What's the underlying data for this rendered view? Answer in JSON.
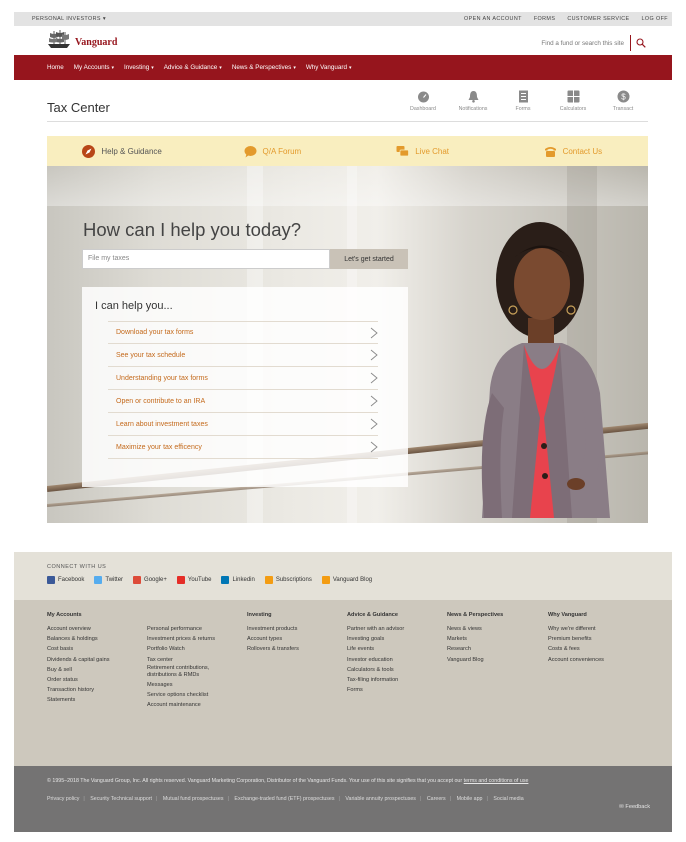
{
  "topbar": {
    "left": "PERSONAL INVESTORS",
    "left_caret": "▾",
    "links": [
      "OPEN AN ACCOUNT",
      "FORMS",
      "CUSTOMER SERVICE",
      "LOG OFF"
    ]
  },
  "brand": {
    "name": "Vanguard",
    "color": "#96151d"
  },
  "search": {
    "placeholder": "Find a fund or search this site"
  },
  "nav": [
    {
      "label": "Home",
      "caret": ""
    },
    {
      "label": "My Accounts",
      "caret": "▾"
    },
    {
      "label": "Investing",
      "caret": "▾"
    },
    {
      "label": "Advice & Guidance",
      "caret": "▾"
    },
    {
      "label": "News & Perspectives",
      "caret": "▾"
    },
    {
      "label": "Why Vanguard",
      "caret": "▾"
    }
  ],
  "page": {
    "title": "Tax Center"
  },
  "quick_tools": [
    {
      "label": "Dashboard",
      "icon": "dashboard-icon"
    },
    {
      "label": "Notifications",
      "icon": "bell-icon"
    },
    {
      "label": "Forms",
      "icon": "forms-icon"
    },
    {
      "label": "Calculators",
      "icon": "calculator-icon"
    },
    {
      "label": "Transact",
      "icon": "dollar-icon"
    }
  ],
  "tabs": [
    {
      "label": "Help & Guidance",
      "icon": "compass-icon",
      "active": true
    },
    {
      "label": "Q/A Forum",
      "icon": "chat-bubble-icon",
      "active": false
    },
    {
      "label": "Live Chat",
      "icon": "live-chat-icon",
      "active": false
    },
    {
      "label": "Contact Us",
      "icon": "phone-icon",
      "active": false
    }
  ],
  "hero": {
    "heading": "How can I help you today?",
    "input_placeholder": "File my taxes",
    "button": "Let's get started",
    "help_title": "I can help you...",
    "help_items": [
      "Download your tax forms",
      "See your tax schedule",
      "Understanding your tax forms",
      "Open or contribute to an IRA",
      "Learn about investment taxes",
      "Maximize your tax efficency"
    ]
  },
  "connect": {
    "label": "CONNECT WITH US",
    "socials": [
      {
        "label": "Facebook",
        "color": "#3b5998"
      },
      {
        "label": "Twitter",
        "color": "#55acee"
      },
      {
        "label": "Google+",
        "color": "#dd4b39"
      },
      {
        "label": "YouTube",
        "color": "#e52d27"
      },
      {
        "label": "Linkedin",
        "color": "#0077b5"
      },
      {
        "label": "Subscriptions",
        "color": "#f39c12"
      },
      {
        "label": "Vanguard Blog",
        "color": "#f39c12"
      }
    ]
  },
  "footer": {
    "my_accounts": {
      "heading": "My Accounts",
      "col1": [
        "Account overview",
        "Balances & holdings",
        "Cost basis",
        "Dividends & capital gains",
        "Buy & sell",
        "Order status",
        "Transaction history",
        "Statements"
      ],
      "col2": [
        "Personal performance",
        "Investment prices & returns",
        "Portfolio Watch",
        "Tax center",
        "Retirement contributions, distributions & RMDs",
        "Messages",
        "Service options checklist",
        "Account maintenance"
      ]
    },
    "investing": {
      "heading": "Investing",
      "items": [
        "Investment products",
        "Account types",
        "Rollovers & transfers"
      ]
    },
    "advice": {
      "heading": "Advice & Guidance",
      "items": [
        "Partner with an advisor",
        "Investing goals",
        "Life events",
        "Investor education",
        "Calculators & tools",
        "Tax-filing information",
        "Forms"
      ]
    },
    "news": {
      "heading": "News & Perspectives",
      "items": [
        "News & views",
        "Markets",
        "Research",
        "Vanguard Blog"
      ]
    },
    "why": {
      "heading": "Why Vanguard",
      "items": [
        "Why we're different",
        "Premium benefits",
        "Costs & fees",
        "Account conveniences"
      ]
    }
  },
  "legal": {
    "copyright": "© 1995–2018 The Vanguard Group, Inc. All rights reserved. Vanguard Marketing Corporation, Distributor of the Vanguard Funds. Your use of this site signifies that you accept our",
    "terms_link": "terms and conditions of use",
    "links": [
      "Privacy policy",
      "Security Technical support",
      "Mutual fund prospectuses",
      "Exchange-traded fund (ETF) prospectuses",
      "Variable annuity prospectuses",
      "Careers",
      "Mobile app",
      "Social media"
    ],
    "feedback": "Feedback"
  }
}
